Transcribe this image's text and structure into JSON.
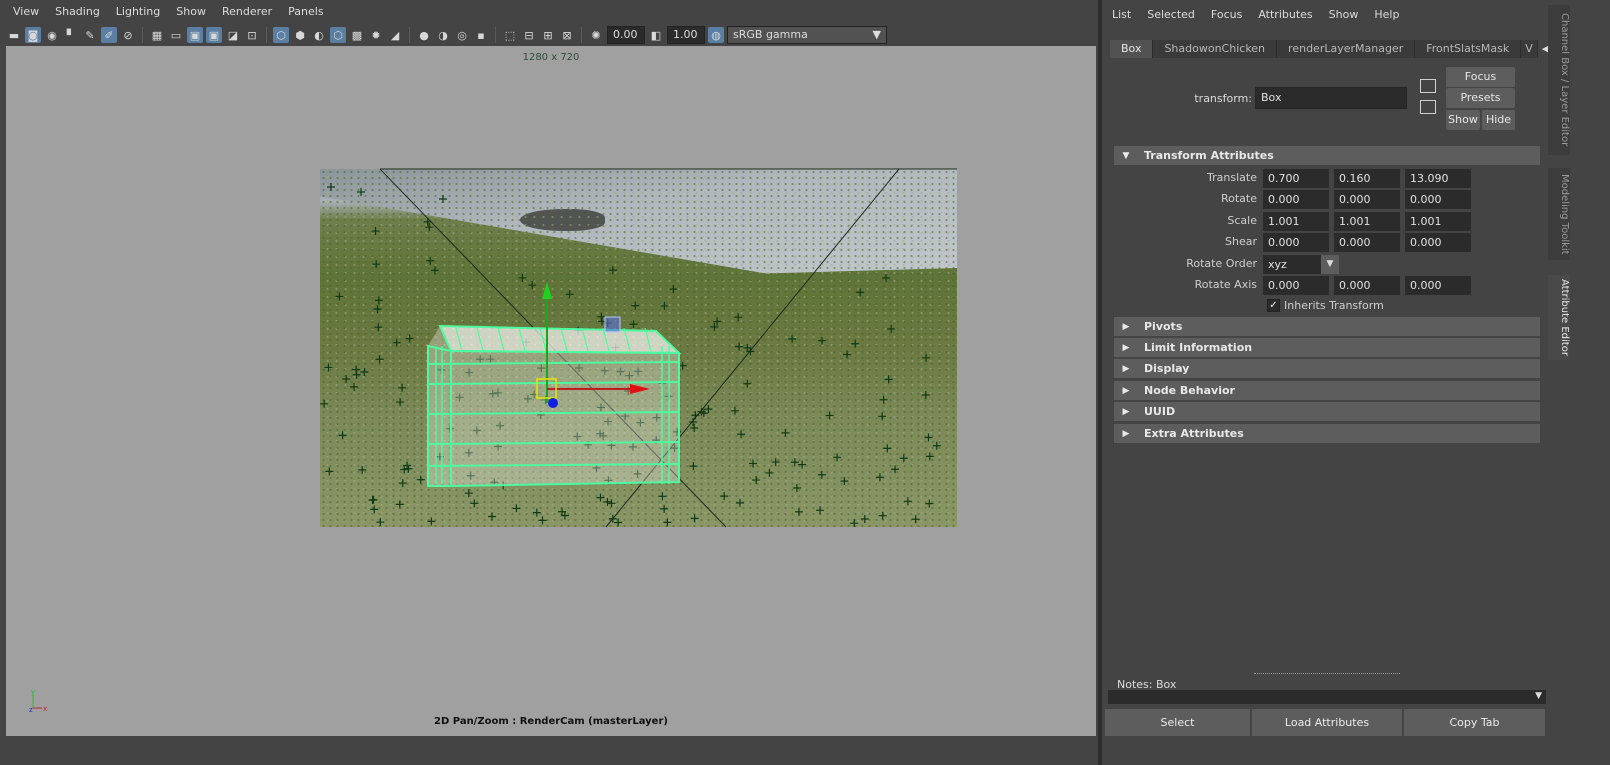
{
  "viewport": {
    "menu": [
      "View",
      "Shading",
      "Lighting",
      "Show",
      "Renderer",
      "Panels"
    ],
    "toolbar": {
      "icons": [
        "select-camera-icon",
        "camera-attributes-icon",
        "bookmark-icon",
        "image-plane-icon",
        "2d-pan-zoom-icon",
        "grease-pencil-icon",
        "grid-icon",
        "film-gate-icon",
        "resolution-gate-icon",
        "gate-mask-icon",
        "field-chart-icon",
        "safe-action-icon",
        "wireframe-icon",
        "smooth-shade-icon",
        "default-material-icon",
        "wireframe-on-shaded-icon",
        "xray-icon",
        "lighting-icon",
        "shadows-icon",
        "screen-space-ao-icon",
        "motion-blur-icon",
        "anti-aliasing-icon",
        "depth-of-field-icon",
        "isolate-select-icon",
        "xray-joints-icon",
        "xray-active-icon",
        "backface-icon",
        "exposure-icon",
        "gamma-icon",
        "color-management-icon"
      ],
      "exposure": "0.00",
      "gamma": "1.00",
      "color_space": "sRGB gamma"
    },
    "resolution": "1280 x 720",
    "camera_label": "2D Pan/Zoom : RenderCam (masterLayer)",
    "colors": {
      "canvas_bg": "#a0a0a0",
      "wireframe": "#4dfaa0",
      "track_marker": "#0f3a14"
    }
  },
  "attribute_editor": {
    "menu": [
      "List",
      "Selected",
      "Focus",
      "Attributes",
      "Show",
      "Help"
    ],
    "tabs": [
      "Box",
      "ShadowonChicken",
      "renderLayerManager",
      "FrontSlatsMask",
      "V"
    ],
    "active_tab": "Box",
    "node_label": "transform:",
    "node_name": "Box",
    "buttons": {
      "focus": "Focus",
      "presets": "Presets",
      "show": "Show",
      "hide": "Hide"
    },
    "transform_section": {
      "title": "Transform Attributes",
      "translate": {
        "label": "Translate",
        "x": "0.700",
        "y": "0.160",
        "z": "13.090"
      },
      "rotate": {
        "label": "Rotate",
        "x": "0.000",
        "y": "0.000",
        "z": "0.000"
      },
      "scale": {
        "label": "Scale",
        "x": "1.001",
        "y": "1.001",
        "z": "1.001"
      },
      "shear": {
        "label": "Shear",
        "x": "0.000",
        "y": "0.000",
        "z": "0.000"
      },
      "rotate_order": {
        "label": "Rotate Order",
        "value": "xyz"
      },
      "rotate_axis": {
        "label": "Rotate Axis",
        "x": "0.000",
        "y": "0.000",
        "z": "0.000"
      },
      "inherits_transform": {
        "label": "Inherits Transform",
        "checked": true
      }
    },
    "collapsed_sections": [
      "Pivots",
      "Limit Information",
      "Display",
      "Node Behavior",
      "UUID",
      "Extra Attributes"
    ],
    "notes_label": "Notes:  Box",
    "bottom_buttons": {
      "select": "Select",
      "load_attributes": "Load Attributes",
      "copy_tab": "Copy Tab"
    }
  },
  "side_tabs": {
    "channel_box": "Channel Box / Layer Editor",
    "modeling_toolkit": "Modeling Toolkit",
    "attribute_editor": "Attribute Editor"
  }
}
